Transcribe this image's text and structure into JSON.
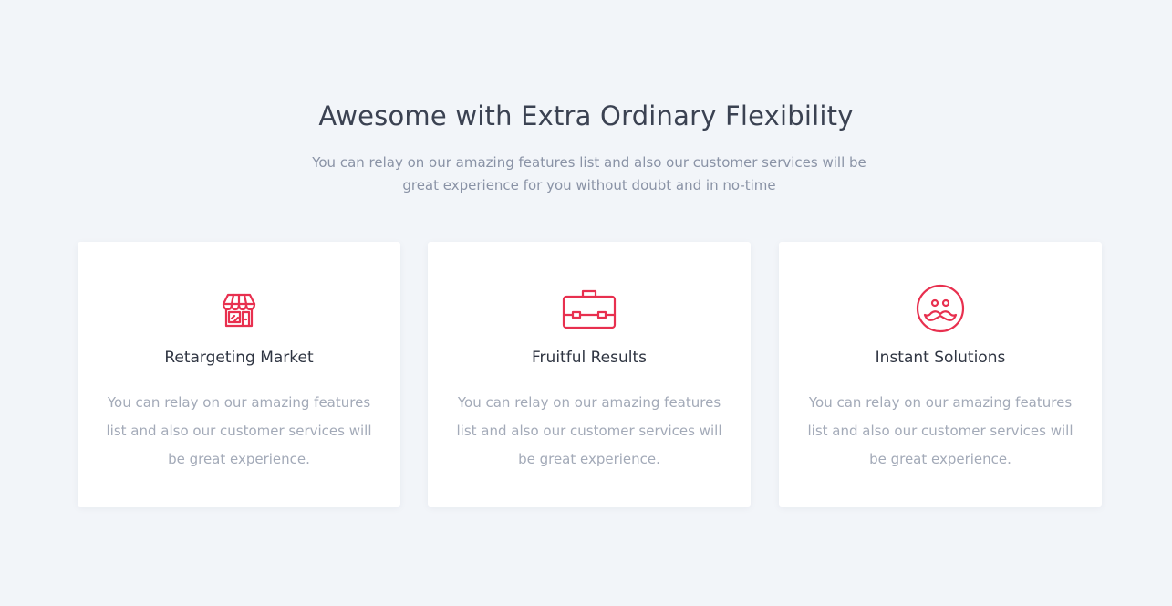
{
  "section": {
    "title": "Awesome with Extra Ordinary Flexibility",
    "subtitle": "You can relay on our amazing features list and also our customer services will be great experience for you without doubt and in no-time"
  },
  "features": [
    {
      "icon": "storefront-icon",
      "title": "Retargeting Market",
      "text": "You can relay on our amazing features list and also our customer services will be great experience."
    },
    {
      "icon": "briefcase-icon",
      "title": "Fruitful Results",
      "text": "You can relay on our amazing features list and also our customer services will be great experience."
    },
    {
      "icon": "mustache-face-icon",
      "title": "Instant Solutions",
      "text": "You can relay on our amazing features list and also our customer services will be great experience."
    }
  ],
  "colors": {
    "background": "#f2f5f9",
    "card": "#ffffff",
    "accent": "#e8304f",
    "heading": "#3b4252",
    "muted": "#a3aab8"
  }
}
